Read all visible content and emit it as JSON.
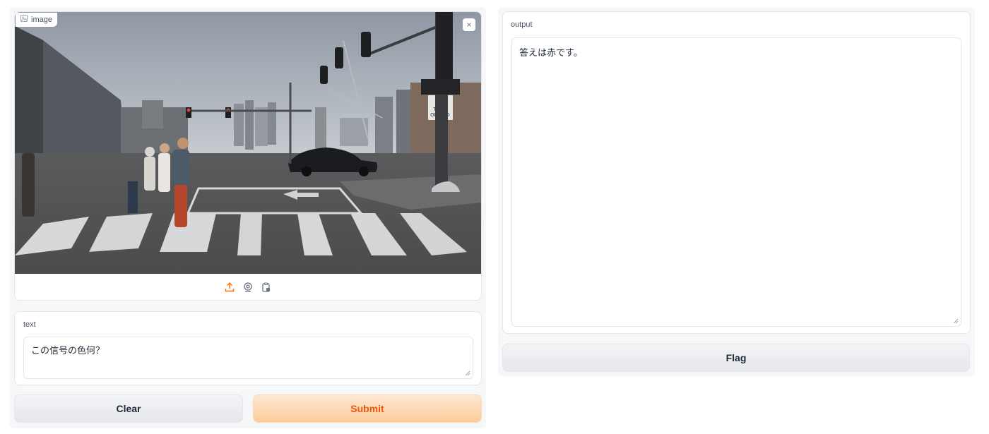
{
  "image_input": {
    "label": "image",
    "close_glyph": "×",
    "scene_signs": [
      "NO",
      "TURN",
      "ON",
      "RED"
    ],
    "source_icons": [
      "upload-icon",
      "webcam-icon",
      "clipboard-icon"
    ]
  },
  "text_input": {
    "label": "text",
    "value": "この信号の色何？"
  },
  "buttons": {
    "clear": "Clear",
    "submit": "Submit",
    "flag": "Flag"
  },
  "output": {
    "label": "output",
    "value": "答えは赤です。"
  },
  "colors": {
    "accent": "#ea580c",
    "submit_bg": "#fdcb9a",
    "panel_bg": "#f6f7f9",
    "border": "#e5e7eb"
  }
}
